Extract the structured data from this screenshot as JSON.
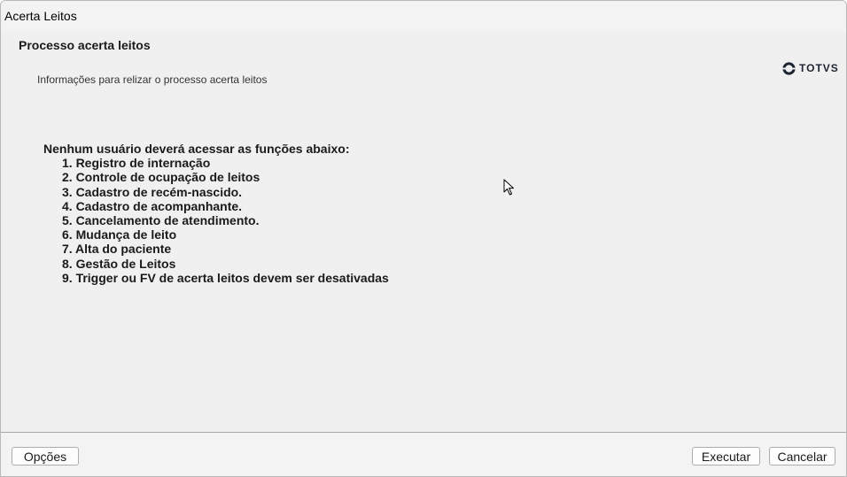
{
  "window": {
    "title": "Acerta Leitos"
  },
  "header": {
    "title": "Processo acerta leitos",
    "subtitle": "Informações para relizar o processo acerta leitos",
    "logo_text": "TOTVS"
  },
  "warning": {
    "heading": "Nenhum usuário deverá acessar as funções abaixo:",
    "items": [
      "1. Registro de internação",
      "2. Controle de ocupação de leitos",
      "3. Cadastro de recém-nascido.",
      "4. Cadastro de acompanhante.",
      "5. Cancelamento de atendimento.",
      "6. Mudança de leito",
      "7. Alta do paciente",
      "8. Gestão de Leitos",
      "9. Trigger ou FV de acerta leitos devem ser desativadas"
    ]
  },
  "footer": {
    "options_label": "Opções",
    "execute_label": "Executar",
    "cancel_label": "Cancelar"
  },
  "colors": {
    "background": "#f0f0f0",
    "logo": "#1c2432"
  },
  "icons": {
    "logo": "totvs-logo-icon",
    "cursor": "mouse-pointer-icon"
  }
}
